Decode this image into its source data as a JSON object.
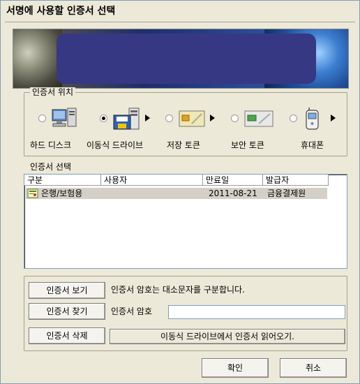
{
  "window": {
    "title": "서명에 사용할 인증서 선택"
  },
  "location_group": {
    "title": "인증서 위치"
  },
  "devices": [
    {
      "label": "하드 디스크",
      "icon": "hard-disk-icon",
      "selected": false
    },
    {
      "label": "이동식 드라이브",
      "icon": "removable-drive-icon",
      "selected": true
    },
    {
      "label": "저장 토큰",
      "icon": "storage-token-icon",
      "selected": false
    },
    {
      "label": "보안 토큰",
      "icon": "security-token-icon",
      "selected": false
    },
    {
      "label": "휴대폰",
      "icon": "mobile-phone-icon",
      "selected": false
    }
  ],
  "cert_select": {
    "title": "인증서 선택",
    "columns": [
      "구분",
      "사용자",
      "만료일",
      "발급자"
    ],
    "rows": [
      {
        "type": "은행/보험용",
        "user": "",
        "expiry": "2011-08-21",
        "issuer": "금융결제원",
        "icon": "certificate-icon"
      }
    ]
  },
  "actions": {
    "view_label": "인증서 보기",
    "view_text": "인증서 암호는 대소문자를 구분합니다.",
    "find_label": "인증서 찾기",
    "password_label": "인증서 암호",
    "password_value": "",
    "delete_label": "인증서 삭제",
    "import_label": "이동식 드라이브에서 인증서 읽어오기."
  },
  "buttons": {
    "ok": "확인",
    "cancel": "취소"
  }
}
